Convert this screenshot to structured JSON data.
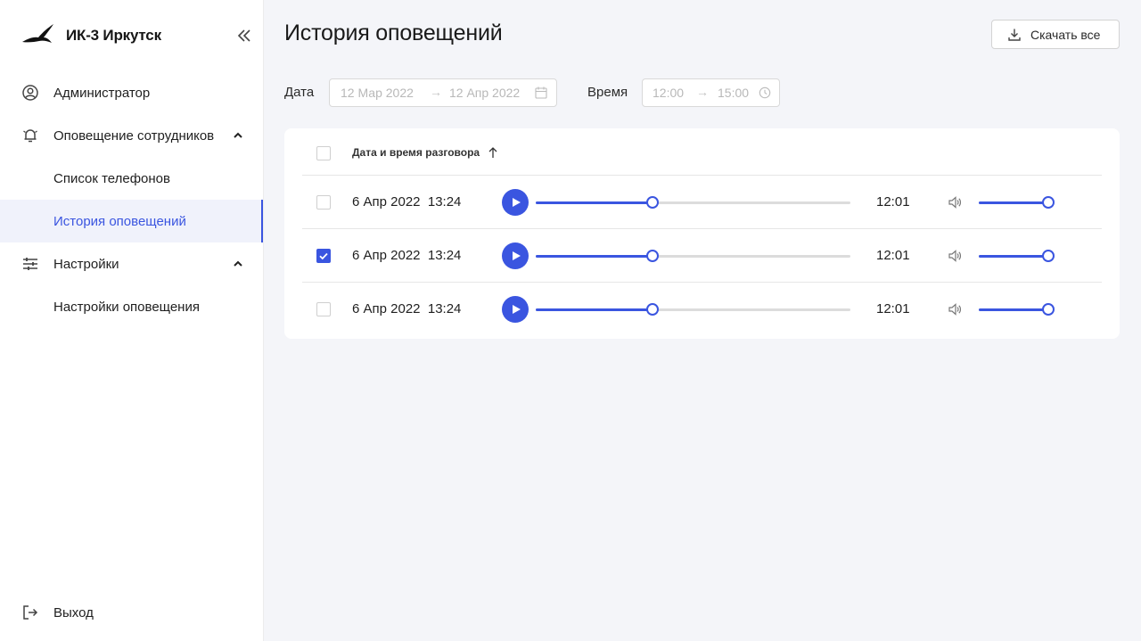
{
  "app": {
    "title": "ИК-3 Иркутск"
  },
  "sidebar": {
    "items": [
      {
        "label": "Администратор",
        "icon": "user-circle-icon"
      },
      {
        "label": "Оповещение сотрудников",
        "icon": "bell-icon",
        "expanded": true
      },
      {
        "label": "Список телефонов"
      },
      {
        "label": "История оповещений",
        "active": true
      },
      {
        "label": "Настройки",
        "icon": "sliders-icon",
        "expanded": true
      },
      {
        "label": "Настройки оповещения"
      }
    ],
    "logout_label": "Выход"
  },
  "page": {
    "title": "История оповещений",
    "download_label": "Скачать все"
  },
  "filters": {
    "date_label": "Дата",
    "date_from": "12 Мар 2022",
    "date_to": "12 Апр 2022",
    "time_label": "Время",
    "time_from": "12:00",
    "time_to": "15:00",
    "arrow": "→"
  },
  "table": {
    "header": "Дата и время разговора",
    "sort": "ascending",
    "rows": [
      {
        "datetime": "6 Апр 2022  13:24",
        "duration": "12:01",
        "checked": false,
        "progress": 0.37,
        "volume": 1.0
      },
      {
        "datetime": "6 Апр 2022  13:24",
        "duration": "12:01",
        "checked": true,
        "progress": 0.37,
        "volume": 1.0
      },
      {
        "datetime": "6 Апр 2022  13:24",
        "duration": "12:01",
        "checked": false,
        "progress": 0.37,
        "volume": 1.0
      }
    ]
  },
  "colors": {
    "accent": "#3a55e0",
    "background": "#f4f5f9",
    "track": "#dcdcdc"
  }
}
